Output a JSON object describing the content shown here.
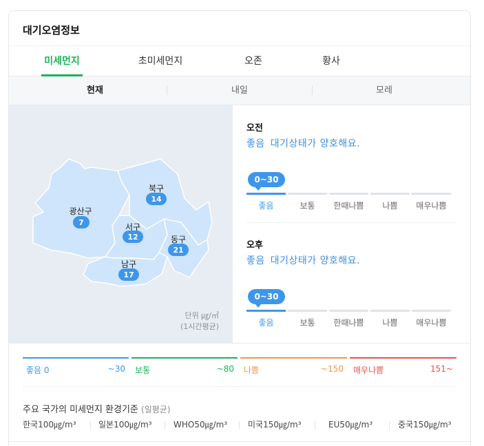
{
  "title": "대기오염정보",
  "tabs": [
    {
      "label": "미세먼지",
      "active": true
    },
    {
      "label": "초미세먼지",
      "active": false
    },
    {
      "label": "오존",
      "active": false
    },
    {
      "label": "황사",
      "active": false
    }
  ],
  "days": [
    {
      "label": "현재",
      "active": true
    },
    {
      "label": "내일",
      "active": false
    },
    {
      "label": "모레",
      "active": false
    }
  ],
  "map": {
    "districts": [
      {
        "name": "광산구",
        "value": "7"
      },
      {
        "name": "북구",
        "value": "14"
      },
      {
        "name": "서구",
        "value": "12"
      },
      {
        "name": "동구",
        "value": "21"
      },
      {
        "name": "남구",
        "value": "17"
      }
    ],
    "unit_line1": "단위 ㎍/㎥",
    "unit_line2": "(1시간평균)",
    "fill_color": "#cfe5fb",
    "badge_color": "#3e96ea"
  },
  "forecast": {
    "am": {
      "period": "오전",
      "grade": "좋음",
      "message": "대기상태가 양호해요.",
      "range": "0~30"
    },
    "pm": {
      "period": "오후",
      "grade": "좋음",
      "message": "대기상태가 양호해요.",
      "range": "0~30"
    },
    "scale_labels": [
      "좋음",
      "보통",
      "한때나쁨",
      "나쁨",
      "매우나쁨"
    ]
  },
  "legend": [
    {
      "label": "좋음 0",
      "range": "~30",
      "color": "#3e96ea"
    },
    {
      "label": "보통",
      "range": "~80",
      "color": "#19b35a"
    },
    {
      "label": "나쁨",
      "range": "~150",
      "color": "#f0944a"
    },
    {
      "label": "매우나쁨",
      "range": "151~",
      "color": "#e5534b"
    }
  ],
  "standards": {
    "title": "주요 국가의 미세먼지 환경기준",
    "subtitle": "(일평균)",
    "items": [
      "한국100㎍/m³",
      "일본100㎍/m³",
      "WHO50㎍/m³",
      "미국150㎍/m³",
      "EU50㎍/m³",
      "중국150㎍/m³"
    ]
  }
}
